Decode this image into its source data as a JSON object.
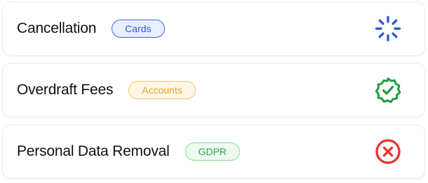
{
  "rows": [
    {
      "title": "Cancellation",
      "tag": "Cards",
      "tag_color": "#2f5ad1",
      "status": "loading",
      "status_icon": "spinner-icon",
      "status_color": "#2f5ad1"
    },
    {
      "title": "Overdraft Fees",
      "tag": "Accounts",
      "tag_color": "#e0a125",
      "status": "verified",
      "status_icon": "verified-badge-icon",
      "status_color": "#1f9d3f"
    },
    {
      "title": "Personal Data Removal",
      "tag": "GDPR",
      "tag_color": "#2fa64d",
      "status": "failed",
      "status_icon": "error-x-icon",
      "status_color": "#e53935"
    }
  ]
}
